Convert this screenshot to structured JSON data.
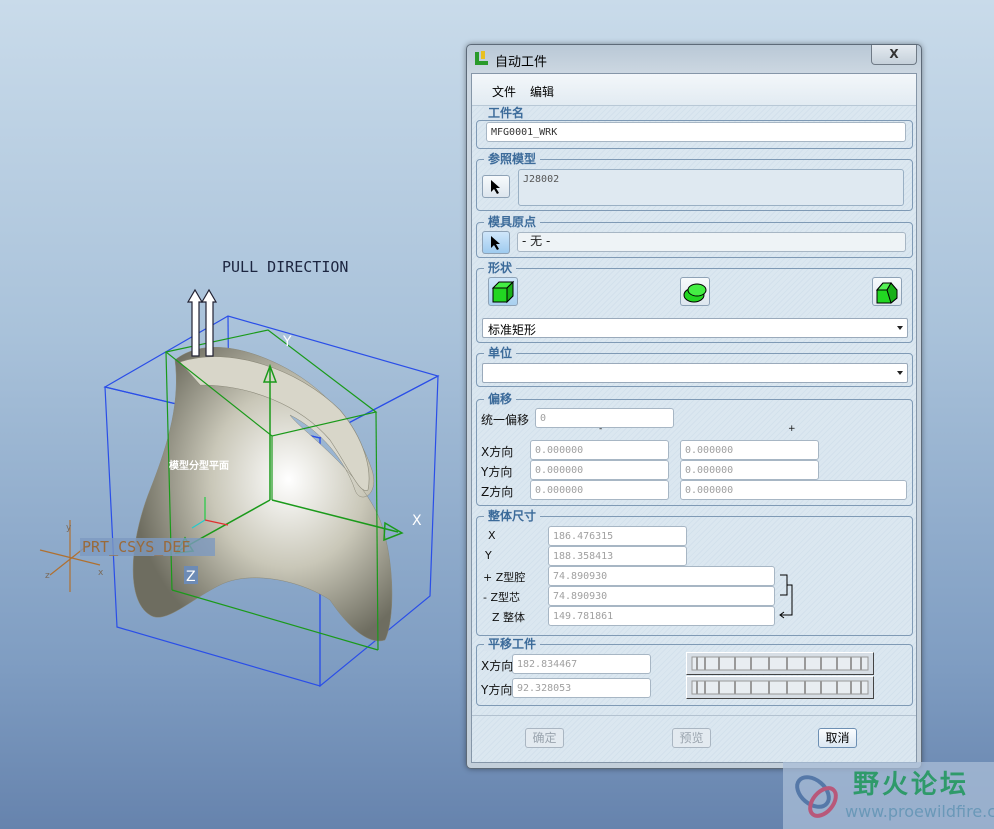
{
  "viewport": {
    "pull_direction_label": "PULL DIRECTION",
    "axis_y_label": "Y",
    "axis_x_label": "X",
    "axis_z_label": "Z",
    "parting_plane_label": "模型分型平面",
    "csys_label": "PRT_CSYS_DEF",
    "csys_axis_x": "x",
    "csys_axis_y": "y",
    "csys_axis_z": "z"
  },
  "dialog": {
    "title": "自动工件",
    "close_label": "X",
    "menu": [
      "文件",
      "编辑"
    ],
    "workpiece_name": {
      "label": "工件名",
      "value": "MFG0001_WRK"
    },
    "reference_model": {
      "label": "参照模型",
      "value": "J28002"
    },
    "mold_origin": {
      "label": "模具原点",
      "value": "- 无 -"
    },
    "shape": {
      "label": "形状",
      "options": [
        "box-icon",
        "cylinder-icon",
        "custom-shape-icon"
      ],
      "selected": "标准矩形"
    },
    "units": {
      "label": "单位",
      "selected": ""
    },
    "offset": {
      "label": "偏移",
      "uniform_label": "统一偏移",
      "uniform_value": "0",
      "minus_label": "-",
      "plus_label": "+",
      "rows": [
        {
          "label": "X方向",
          "minus": "0.000000",
          "plus": "0.000000"
        },
        {
          "label": "Y方向",
          "minus": "0.000000",
          "plus": "0.000000"
        },
        {
          "label": "Z方向",
          "minus": "0.000000",
          "plus": "0.000000"
        }
      ]
    },
    "overall_size": {
      "label": "整体尺寸",
      "x_label": "X",
      "x_value": "186.476315",
      "y_label": "Y",
      "y_value": "188.358413",
      "z_cavity_label": "+ Z型腔",
      "z_cavity_value": "74.890930",
      "z_core_label": "- Z型芯",
      "z_core_value": "74.890930",
      "z_total_label": "Z 整体",
      "z_total_value": "149.781861"
    },
    "translate": {
      "label": "平移工件",
      "x_label": "X方向",
      "x_value": "182.834467",
      "y_label": "Y方向",
      "y_value": "92.328053"
    },
    "buttons": {
      "ok": "确定",
      "preview": "预览",
      "cancel": "取消"
    }
  },
  "watermark": {
    "text": "野火论坛",
    "url": "www.proewildfire.cn"
  },
  "colors": {
    "shape_green": "#22d622",
    "group_label": "#3c6b9a",
    "box_blue": "#2a4ee8",
    "box_green": "#1a9a1a"
  }
}
